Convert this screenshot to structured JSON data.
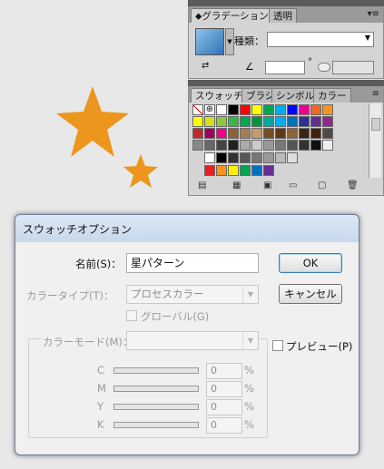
{
  "gradient_panel": {
    "tabs": [
      {
        "label": "⬥グラデーション"
      },
      {
        "label": "透明"
      }
    ],
    "type_label": "種類：",
    "angle_symbol": "∠",
    "degree": "°"
  },
  "swatch_panel": {
    "tabs": [
      {
        "label": "スウォッチ"
      },
      {
        "label": "ブラシ"
      },
      {
        "label": "シンボル"
      },
      {
        "label": "カラー"
      }
    ],
    "rows": [
      [
        "none",
        "register",
        "#ffffff",
        "#000000",
        "#ff0000",
        "#ffff00",
        "#00a651",
        "#00aeef",
        "#0000ff",
        "#ec008c",
        "#f26522",
        "#f7941d"
      ],
      [
        "#ffff00",
        "#d7df23",
        "#8dc63f",
        "#39b54a",
        "#00a651",
        "#009444",
        "#00a99d",
        "#00aeef",
        "#0072bc",
        "#2e3192",
        "#662d91",
        "#92278f"
      ],
      [
        "#c1272d",
        "#9e005d",
        "#ec008c",
        "#8c6239",
        "#a67c52",
        "#c69c6d",
        "#754c24",
        "#603813",
        "#8c6239",
        "#3b2314",
        "#42210b",
        "#534741"
      ],
      [
        "#888888",
        "#666666",
        "#444444",
        "#222222",
        "#aaaaaa",
        "#cccccc",
        "#999999",
        "#777777",
        "#555555",
        "#333333",
        "#111111",
        "#eeeeee"
      ]
    ],
    "footer_row": [
      "#ffffff",
      "#000000",
      "#333333",
      "#555555",
      "#777777",
      "#999999",
      "#bbbbbb",
      "#dddddd"
    ],
    "folder_row": [
      "#ed1c24",
      "#f7941d",
      "#fff200",
      "#00a651",
      "#0072bc",
      "#662d91"
    ]
  },
  "dialog": {
    "title": "スウォッチオプション",
    "name_label": "名前(S)：",
    "name_value": "星パターン",
    "type_label": "カラータイプ(T)：",
    "type_value": "プロセスカラー",
    "global_label": "グローバル(G)",
    "mode_label": "カラーモード(M)：",
    "mode_value": "",
    "ok_label": "OK",
    "cancel_label": "キャンセル",
    "preview_label": "プレビュー(P)",
    "channels": [
      {
        "name": "C",
        "value": "0",
        "unit": "%"
      },
      {
        "name": "M",
        "value": "0",
        "unit": "%"
      },
      {
        "name": "Y",
        "value": "0",
        "unit": "%"
      },
      {
        "name": "K",
        "value": "0",
        "unit": "%"
      }
    ]
  },
  "colors": {
    "star": "#ec961e",
    "accent": "#3c7fb1"
  }
}
